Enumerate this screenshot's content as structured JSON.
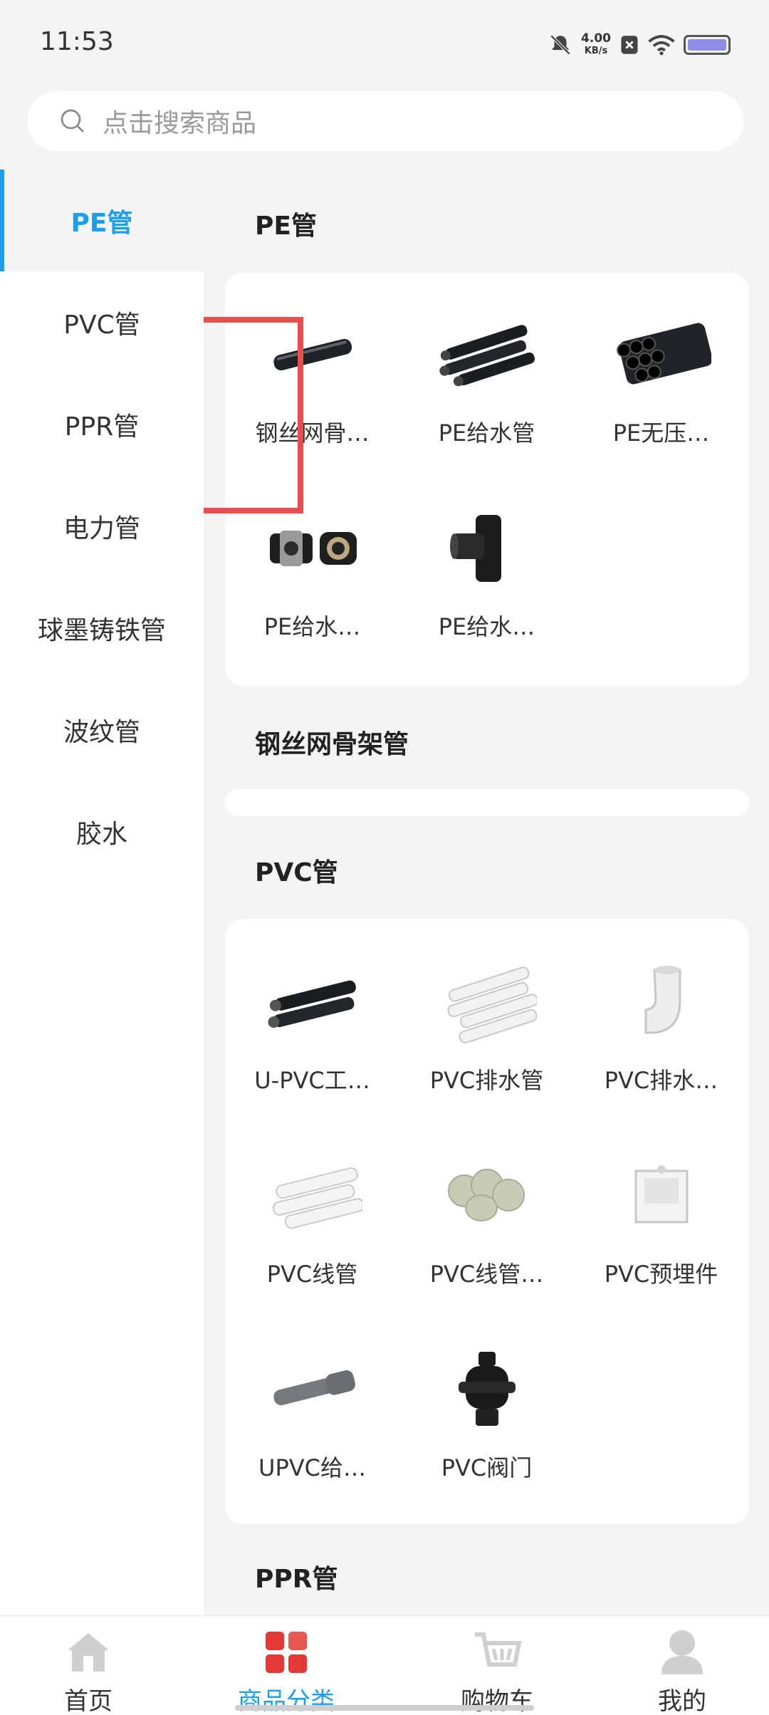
{
  "status": {
    "time": "11:53",
    "speed_value": "4.00",
    "speed_unit": "KB/s"
  },
  "search": {
    "placeholder": "点击搜索商品"
  },
  "sidebar": {
    "items": [
      {
        "label": "PE管"
      },
      {
        "label": "PVC管"
      },
      {
        "label": "PPR管"
      },
      {
        "label": "电力管"
      },
      {
        "label": "球墨铸铁管"
      },
      {
        "label": "波纹管"
      },
      {
        "label": "胶水"
      }
    ]
  },
  "sections": [
    {
      "title": "PE管",
      "products": [
        {
          "name": "钢丝网骨…",
          "icon": "black-pipe-single-icon"
        },
        {
          "name": "PE给水管",
          "icon": "black-pipes-icon"
        },
        {
          "name": "PE无压…",
          "icon": "black-pipe-bundle-icon"
        },
        {
          "name": "PE给水…",
          "icon": "pipe-fittings-icon"
        },
        {
          "name": "PE给水…",
          "icon": "tee-fitting-icon"
        }
      ]
    },
    {
      "title": "钢丝网骨架管",
      "products": []
    },
    {
      "title": "PVC管",
      "products": [
        {
          "name": "U-PVC工…",
          "icon": "black-pipes-icon"
        },
        {
          "name": "PVC排水管",
          "icon": "white-pipes-icon"
        },
        {
          "name": "PVC排水…",
          "icon": "elbow-fitting-icon"
        },
        {
          "name": "PVC线管",
          "icon": "white-pipes-icon"
        },
        {
          "name": "PVC线管…",
          "icon": "pipe-caps-icon"
        },
        {
          "name": "PVC预埋件",
          "icon": "junction-box-icon"
        },
        {
          "name": "UPVC给…",
          "icon": "gray-pipe-icon"
        },
        {
          "name": "PVC阀门",
          "icon": "valve-icon"
        }
      ]
    },
    {
      "title": "PPR管",
      "products": []
    }
  ],
  "tabbar": {
    "items": [
      {
        "label": "首页",
        "icon": "home-icon"
      },
      {
        "label": "商品分类",
        "icon": "category-icon"
      },
      {
        "label": "购物车",
        "icon": "cart-icon"
      },
      {
        "label": "我的",
        "icon": "profile-icon"
      }
    ]
  },
  "colors": {
    "accent": "#1a9ef0",
    "highlight": "#e8504f",
    "category_red": "#e53935"
  }
}
